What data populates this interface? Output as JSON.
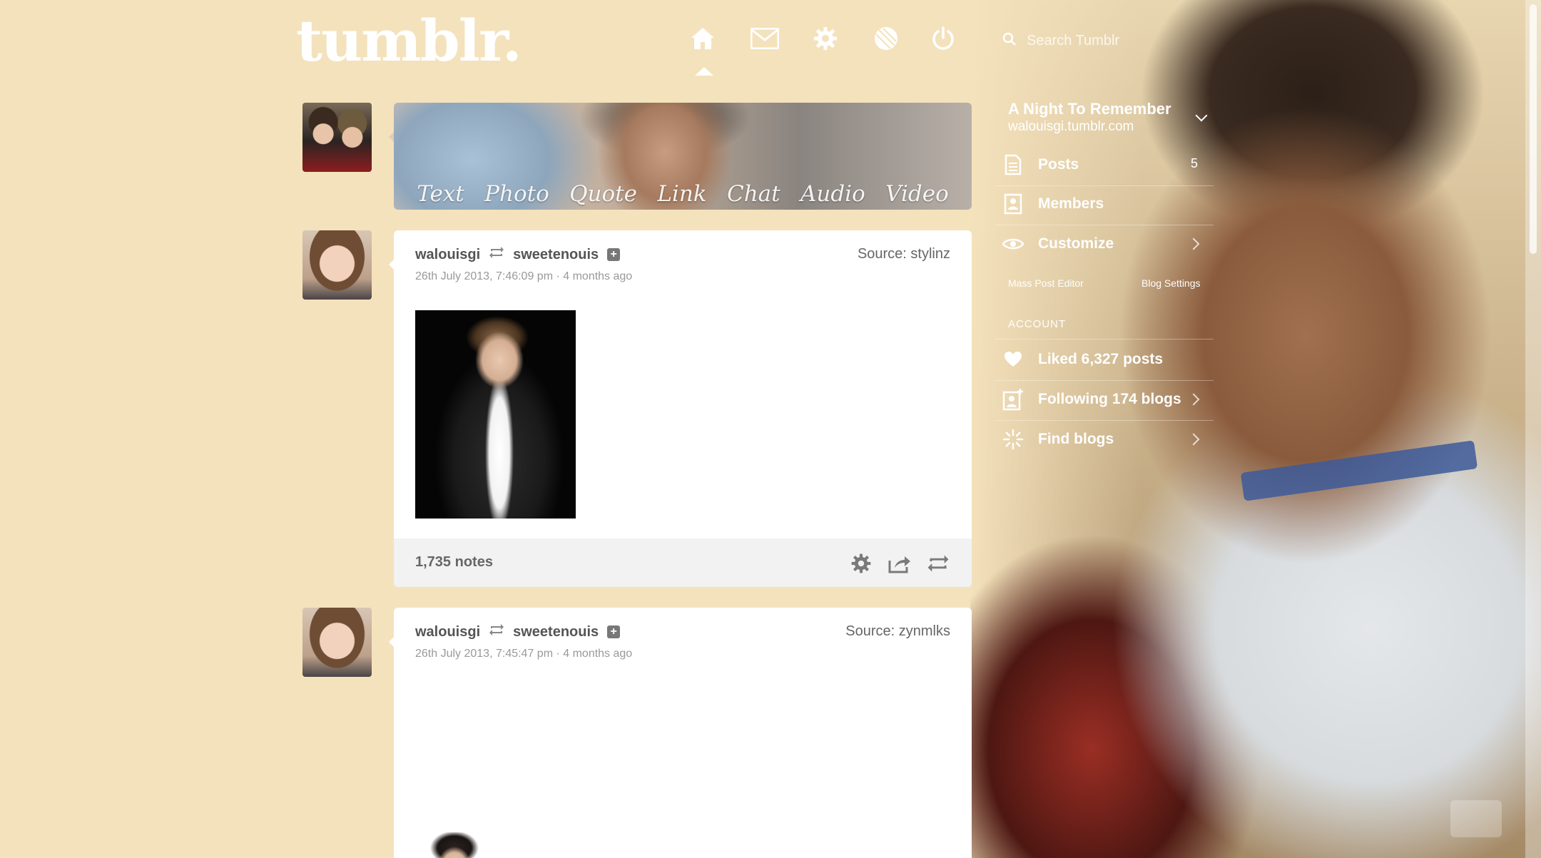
{
  "brand": {
    "logo_text": "tumblr."
  },
  "nav": {
    "icons": [
      "home-icon",
      "mail-icon",
      "gear-icon",
      "radar-icon",
      "power-icon"
    ],
    "active": "home"
  },
  "search": {
    "placeholder": "Search Tumblr"
  },
  "composer": {
    "tabs": [
      "Text",
      "Photo",
      "Quote",
      "Link",
      "Chat",
      "Audio",
      "Video"
    ]
  },
  "posts": [
    {
      "author": "walouisgi",
      "reblogged_from": "sweetenouis",
      "date": "26th July 2013, 7:46:09 pm · 4 months ago",
      "source": "Source: stylinz",
      "notes": "1,735 notes"
    },
    {
      "author": "walouisgi",
      "reblogged_from": "sweetenouis",
      "date": "26th July 2013, 7:45:47 pm · 4 months ago",
      "source": "Source: zynmlks"
    }
  ],
  "sidebar": {
    "blog_title": "A Night To Remember",
    "blog_url": "walouisgi.tumblr.com",
    "items": [
      {
        "label": "Posts",
        "count": "5"
      },
      {
        "label": "Members"
      },
      {
        "label": "Customize"
      }
    ],
    "mass_post_editor": "Mass Post Editor",
    "blog_settings": "Blog Settings",
    "account_heading": "ACCOUNT",
    "account_items": [
      {
        "label": "Liked 6,327 posts"
      },
      {
        "label": "Following 174 blogs"
      },
      {
        "label": "Find blogs"
      }
    ]
  },
  "colors": {
    "background": "#f4e2bc",
    "card": "#ffffff",
    "footer": "#f2f2f2"
  }
}
